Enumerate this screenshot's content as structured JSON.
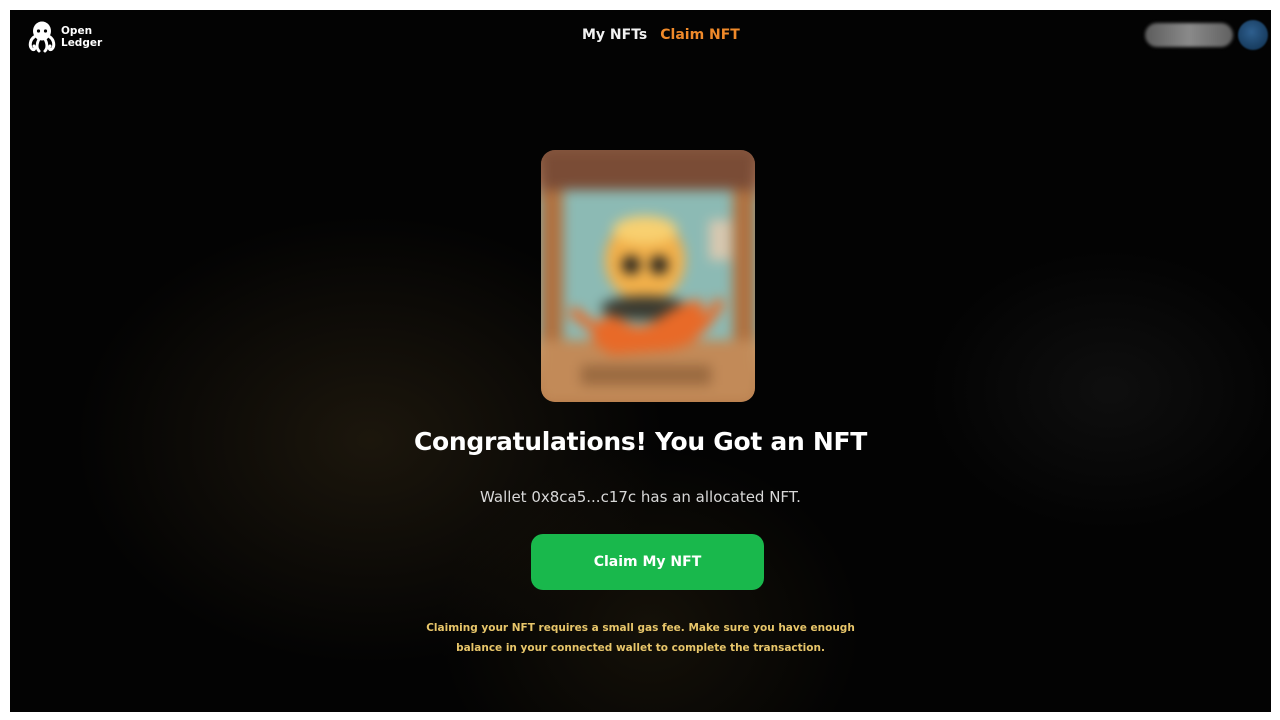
{
  "brand": {
    "line1": "Open",
    "line2": "Ledger",
    "logo_icon": "octopus-icon"
  },
  "nav": {
    "items": [
      {
        "label": "My NFTs"
      },
      {
        "label": "Claim NFT"
      }
    ],
    "active_color": "#f08a2a"
  },
  "main": {
    "headline": "Congratulations! You Got an NFT",
    "wallet_message": "Wallet 0x8ca5...c17c has an allocated NFT.",
    "claim_button": "Claim My NFT",
    "gas_note": "Claiming your NFT requires a small gas fee. Make sure you have enough balance in your connected wallet to complete the transaction."
  },
  "colors": {
    "button": "#19b84c",
    "note": "#e8c66a",
    "background": "#030303"
  }
}
